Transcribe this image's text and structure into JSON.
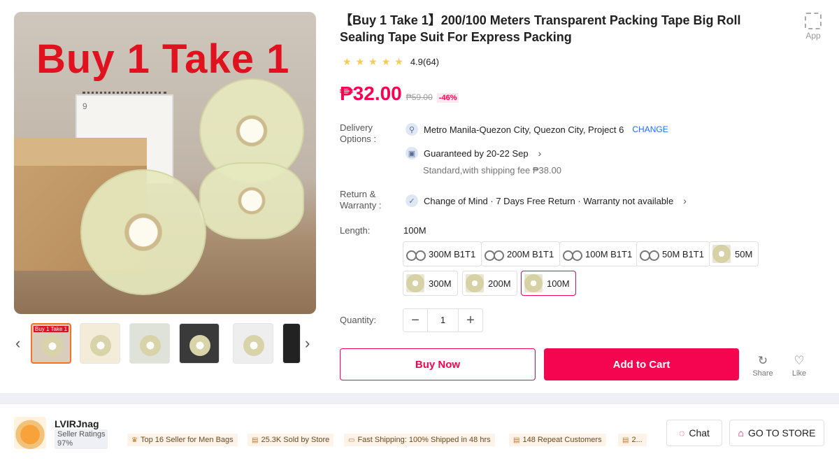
{
  "gallery": {
    "overlay_text": "Buy 1 Take 1",
    "calendar_number": "9",
    "prev_arrow": "‹",
    "next_arrow": "›",
    "thumbs": [
      {
        "label": "Buy 1 Take 1",
        "active": true
      },
      {
        "label": "",
        "active": false
      },
      {
        "label": "",
        "active": false
      },
      {
        "label": "",
        "active": false
      },
      {
        "label": "",
        "active": false
      },
      {
        "label": "",
        "active": false
      }
    ]
  },
  "product": {
    "title": "【Buy 1 Take 1】200/100 Meters Transparent Packing Tape Big Roll Sealing Tape Suit For Express Packing",
    "rating_value": "4.9(64)",
    "stars": 5,
    "price": "₱32.00",
    "old_price": "₱59.00",
    "discount": "-46%"
  },
  "app_link": {
    "label": "App"
  },
  "delivery": {
    "label": "Delivery Options :",
    "location": "Metro Manila-Quezon City, Quezon City, Project 6",
    "change_label": "CHANGE",
    "guarantee": "Guaranteed by 20-22 Sep",
    "shipping": "Standard,with shipping fee ₱38.00"
  },
  "return": {
    "label": "Return & Warranty :",
    "text": "Change of Mind · 7 Days Free Return · Warranty not available"
  },
  "length": {
    "label": "Length:",
    "selected": "100M",
    "options": [
      {
        "label": "300M B1T1",
        "selected": false
      },
      {
        "label": "200M B1T1",
        "selected": false
      },
      {
        "label": "100M B1T1",
        "selected": false
      },
      {
        "label": "50M B1T1",
        "selected": false
      },
      {
        "label": "50M",
        "selected": false
      },
      {
        "label": "300M",
        "selected": false
      },
      {
        "label": "200M",
        "selected": false
      },
      {
        "label": "100M",
        "selected": true
      }
    ]
  },
  "quantity": {
    "label": "Quantity:",
    "value": "1",
    "minus": "−",
    "plus": "+"
  },
  "actions": {
    "buy_now": "Buy Now",
    "add_to_cart": "Add to Cart",
    "share": "Share",
    "like": "Like"
  },
  "seller": {
    "name": "LVIRJnag",
    "ratings_label": "Seller Ratings",
    "ratings_value": "97%",
    "tags": [
      "Top 16 Seller for Men Bags",
      "25.3K Sold by Store",
      "Fast Shipping: 100% Shipped in 48 hrs",
      "148 Repeat Customers",
      "2..."
    ],
    "chat_label": "Chat",
    "store_label": "GO TO STORE"
  },
  "colors": {
    "accent": "#f5054f",
    "link": "#1a71ff",
    "star": "#faca51"
  }
}
